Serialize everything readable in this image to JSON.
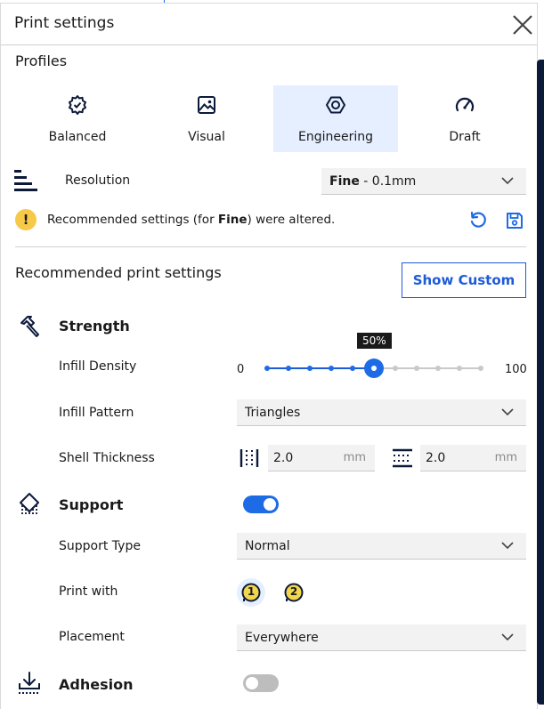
{
  "header": {
    "title": "Print settings"
  },
  "profiles": {
    "label": "Profiles",
    "items": [
      {
        "label": "Balanced",
        "icon": "gear-check-icon"
      },
      {
        "label": "Visual",
        "icon": "image-icon"
      },
      {
        "label": "Engineering",
        "icon": "hexagon-nut-icon",
        "selected": true
      },
      {
        "label": "Draft",
        "icon": "gauge-icon"
      }
    ]
  },
  "resolution": {
    "label": "Resolution",
    "value_bold": "Fine",
    "value_rest": " - 0.1mm"
  },
  "warning": {
    "text_before": "Recommended settings (for ",
    "text_bold": "Fine",
    "text_after": ") were altered."
  },
  "recommended": {
    "title": "Recommended print settings",
    "show_custom": "Show Custom"
  },
  "strength": {
    "title": "Strength",
    "infill_density": {
      "label": "Infill Density",
      "min": "0",
      "max": "100",
      "value": 50,
      "tooltip": "50%"
    },
    "infill_pattern": {
      "label": "Infill Pattern",
      "value": "Triangles"
    },
    "shell_thickness": {
      "label": "Shell Thickness",
      "wall": "2.0",
      "topbottom": "2.0",
      "unit": "mm"
    }
  },
  "support": {
    "title": "Support",
    "enabled": true,
    "support_type": {
      "label": "Support Type",
      "value": "Normal"
    },
    "print_with": {
      "label": "Print with",
      "extruders": [
        "1",
        "2"
      ]
    },
    "placement": {
      "label": "Placement",
      "value": "Everywhere"
    }
  },
  "adhesion": {
    "title": "Adhesion",
    "enabled": false
  },
  "colors": {
    "accent": "#1e6be6",
    "selected_bg": "#e6efff",
    "warning": "#f7c948",
    "extruder_ring": "#f2d64b"
  }
}
